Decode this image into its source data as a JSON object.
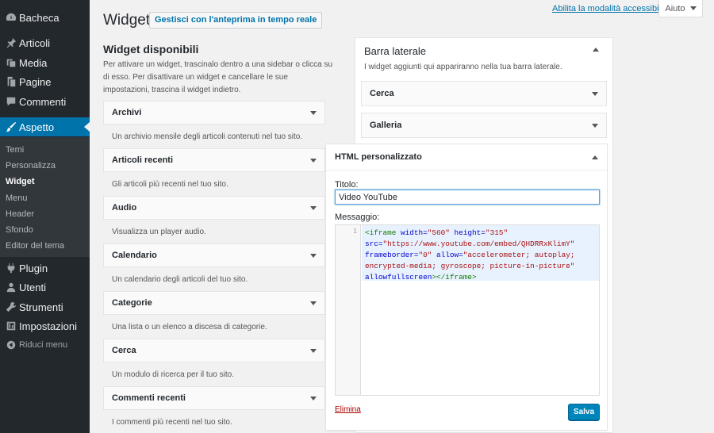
{
  "menu": {
    "items": [
      {
        "label": "Bacheca",
        "icon": "dashboard-icon"
      },
      {
        "label": "Articoli",
        "icon": "pin-icon"
      },
      {
        "label": "Media",
        "icon": "media-icon"
      },
      {
        "label": "Pagine",
        "icon": "pages-icon"
      },
      {
        "label": "Commenti",
        "icon": "comments-icon"
      },
      {
        "label": "Aspetto",
        "icon": "brush-icon"
      },
      {
        "label": "Plugin",
        "icon": "plugin-icon"
      },
      {
        "label": "Utenti",
        "icon": "users-icon"
      },
      {
        "label": "Strumenti",
        "icon": "tools-icon"
      },
      {
        "label": "Impostazioni",
        "icon": "settings-icon"
      }
    ],
    "submenu": [
      "Temi",
      "Personalizza",
      "Widget",
      "Menu",
      "Header",
      "Sfondo",
      "Editor del tema"
    ],
    "collapse_label": "Riduci menu"
  },
  "header": {
    "title": "Widget",
    "live_preview": "Gestisci con l'anteprima in tempo reale",
    "a11y_link": "Abilita la modalità accessibile",
    "help": "Aiuto"
  },
  "available": {
    "title": "Widget disponibili",
    "description": "Per attivare un widget, trascinalo dentro a una sidebar o clicca su di esso. Per disattivare un widget e cancellare le sue impostazioni, trascina il widget indietro.",
    "widgets": [
      {
        "title": "Archivi",
        "desc": "Un archivio mensile degli articoli contenuti nel tuo sito."
      },
      {
        "title": "Articoli recenti",
        "desc": "Gli articoli più recenti nel tuo sito."
      },
      {
        "title": "Audio",
        "desc": "Visualizza un player audio."
      },
      {
        "title": "Calendario",
        "desc": "Un calendario degli articoli del tuo sito."
      },
      {
        "title": "Categorie",
        "desc": "Una lista o un elenco a discesa di categorie."
      },
      {
        "title": "Cerca",
        "desc": "Un modulo di ricerca per il tuo sito."
      },
      {
        "title": "Commenti recenti",
        "desc": "I commenti più recenti nel tuo sito."
      }
    ]
  },
  "sidebar": {
    "title": "Barra laterale",
    "description": "I widget aggiunti qui appariranno nella tua barra laterale.",
    "widgets": [
      "Cerca",
      "Galleria"
    ]
  },
  "html_widget": {
    "title": "HTML personalizzato",
    "title_label": "Titolo:",
    "title_value": "Video YouTube",
    "message_label": "Messaggio:",
    "line_number": "1",
    "code": {
      "t1": "<iframe",
      "a1": " width=",
      "s1": "\"560\"",
      "a2": " height=",
      "s2": "\"315\"",
      "a3": "src=",
      "s3": "\"https://www.youtube.com/embed/QHDRRxKlimY\"",
      "a4": "frameborder=",
      "s4": "\"0\"",
      "a5": " allow=",
      "s5": "\"accelerometer; autoplay;",
      "s6": "encrypted-media; gyroscope; picture-in-picture\"",
      "a6": "allowfullscreen",
      "t2": "></iframe>"
    },
    "delete_label": "Elimina",
    "save_label": "Salva"
  }
}
